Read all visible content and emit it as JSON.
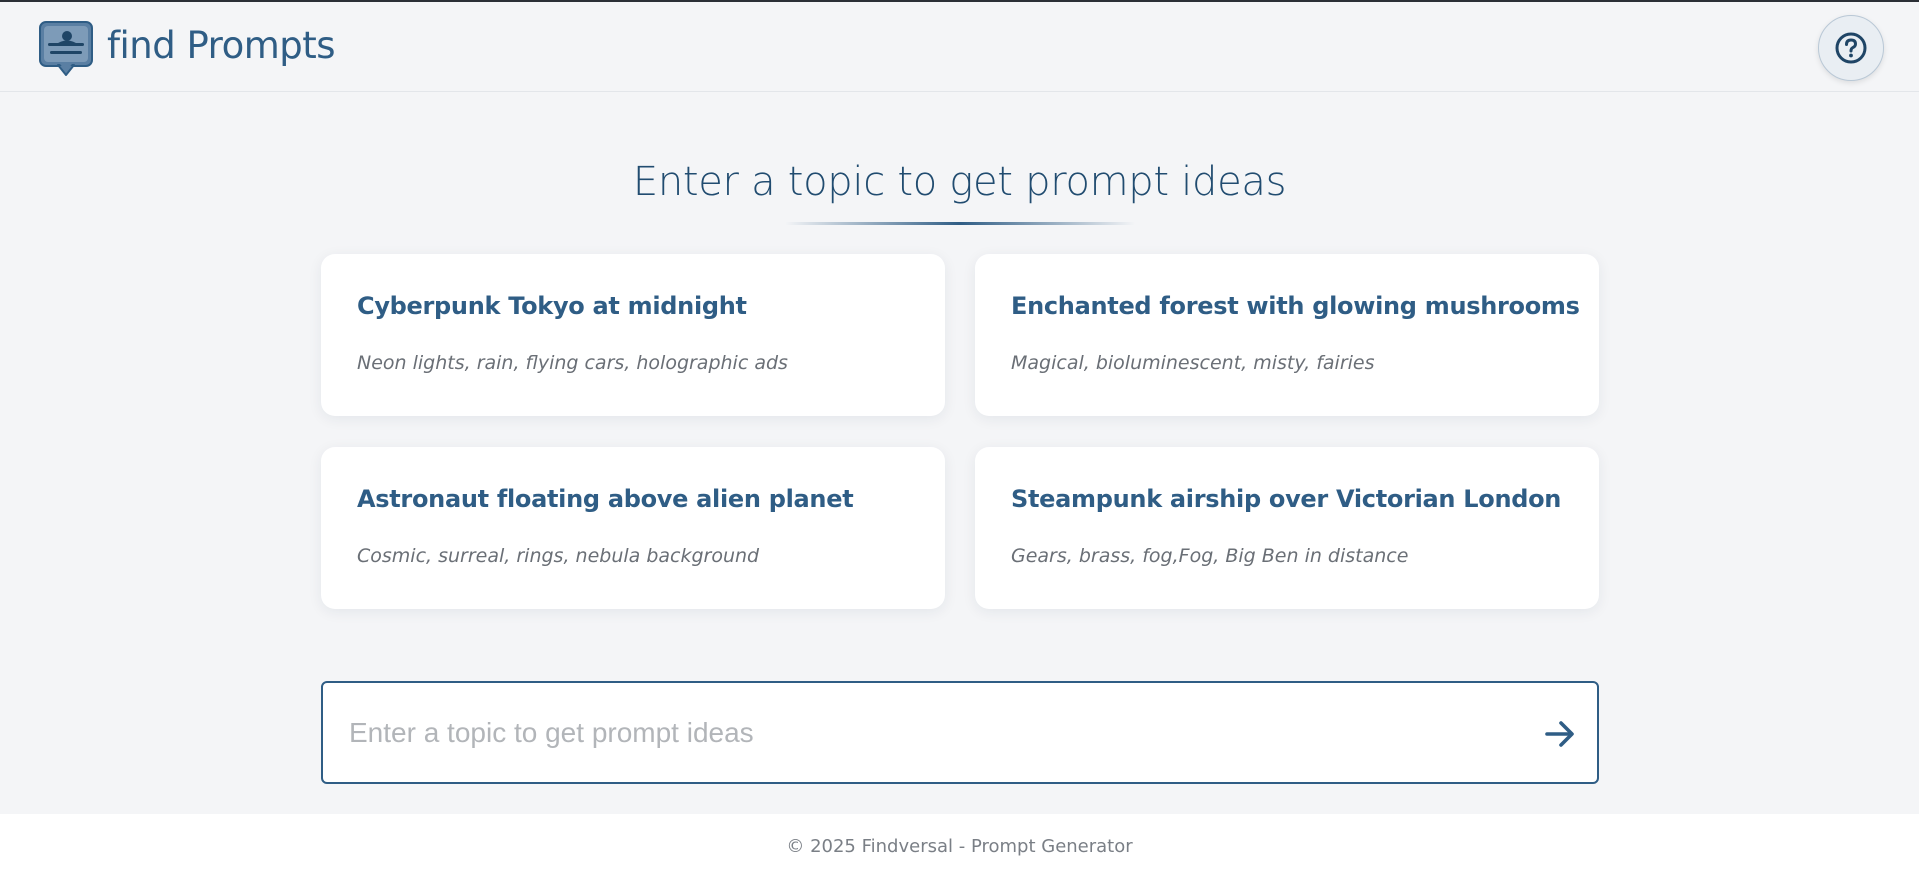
{
  "header": {
    "brand": "find Prompts",
    "logo_icon": "chat-bubble-person-icon",
    "help_icon": "question-circle-icon"
  },
  "hero": {
    "title": "Enter a topic to get prompt ideas"
  },
  "cards": [
    {
      "title": "Cyberpunk Tokyo at midnight",
      "description": "Neon lights, rain, flying cars, holographic ads"
    },
    {
      "title": "Enchanted forest with glowing mushrooms",
      "description": "Magical, bioluminescent, misty, fairies"
    },
    {
      "title": "Astronaut floating above alien planet",
      "description": "Cosmic, surreal, rings, nebula background"
    },
    {
      "title": "Steampunk airship over Victorian London",
      "description": "Gears, brass, fog,Fog, Big Ben in distance"
    }
  ],
  "search": {
    "value": "",
    "placeholder": "Enter a topic to get prompt ideas",
    "submit_icon": "arrow-right-icon"
  },
  "footer": {
    "text": "© 2025 Findversal - Prompt Generator"
  },
  "colors": {
    "brand": "#2f5d85",
    "background": "#f4f5f7",
    "card": "#ffffff",
    "muted_text": "#6a6f76"
  }
}
